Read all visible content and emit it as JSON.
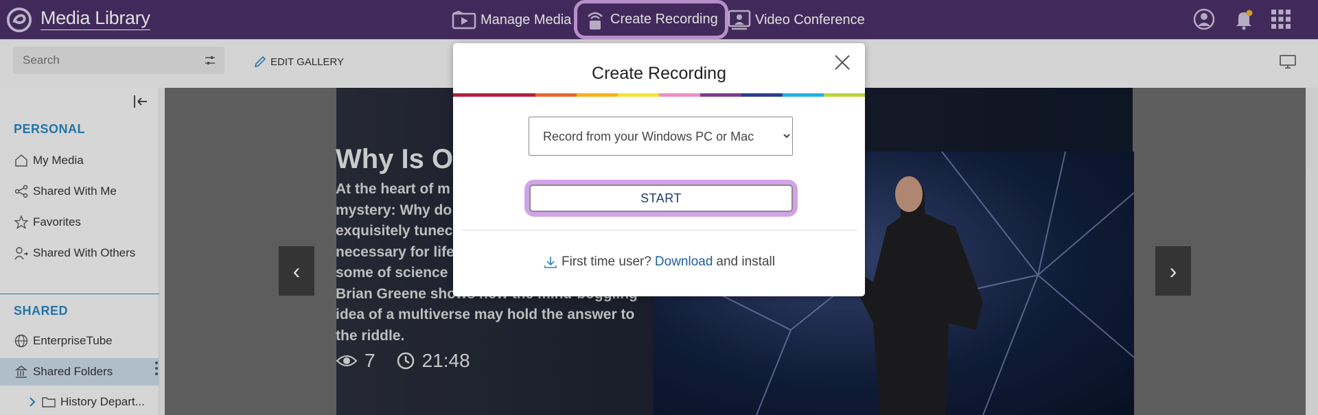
{
  "app": {
    "title": "Media Library"
  },
  "nav": {
    "manage": "Manage Media",
    "create": "Create Recording",
    "conference": "Video Conference"
  },
  "toolbar": {
    "search_placeholder": "Search",
    "edit_gallery": "EDIT GALLERY"
  },
  "sidebar": {
    "personal_heading": "PERSONAL",
    "personal_items": [
      "My Media",
      "Shared With Me",
      "Favorites",
      "Shared With Others"
    ],
    "shared_heading": "SHARED",
    "shared_items": [
      "EnterpriseTube",
      "Shared Folders"
    ],
    "folder_item": "History Depart..."
  },
  "hero": {
    "title": "Why Is O",
    "description": "At the heart of m mystery: Why do exquisitely tune necessary for life some of science Brian Greene shows how the mind-boggling idea of a multiverse may hold the answer to the riddle.",
    "desc_lines": [
      "At the heart of m",
      "mystery: Why do",
      "exquisitely tunec",
      "necessary for life",
      "some of science",
      "Brian Greene shows how the mind-boggling",
      "idea of a multiverse may hold the answer to",
      "the riddle."
    ],
    "views": "7",
    "duration": "21:48",
    "prev": "‹",
    "next": "›"
  },
  "modal": {
    "title": "Create Recording",
    "select_value": "Record from your Windows PC or Mac",
    "start_label": "START",
    "first_time": "First time user?",
    "download": "Download",
    "install": "and install"
  },
  "colors": {
    "topbar": "#4b3068",
    "highlight": "#d2a3e6",
    "accent": "#2b84bd",
    "rainbow": [
      "#b2203f",
      "#e8692f",
      "#f5b21d",
      "#f4e33b",
      "#ec8fc4",
      "#7d3b8c",
      "#2c3e8f",
      "#1fb3e5",
      "#b9d53a"
    ]
  }
}
